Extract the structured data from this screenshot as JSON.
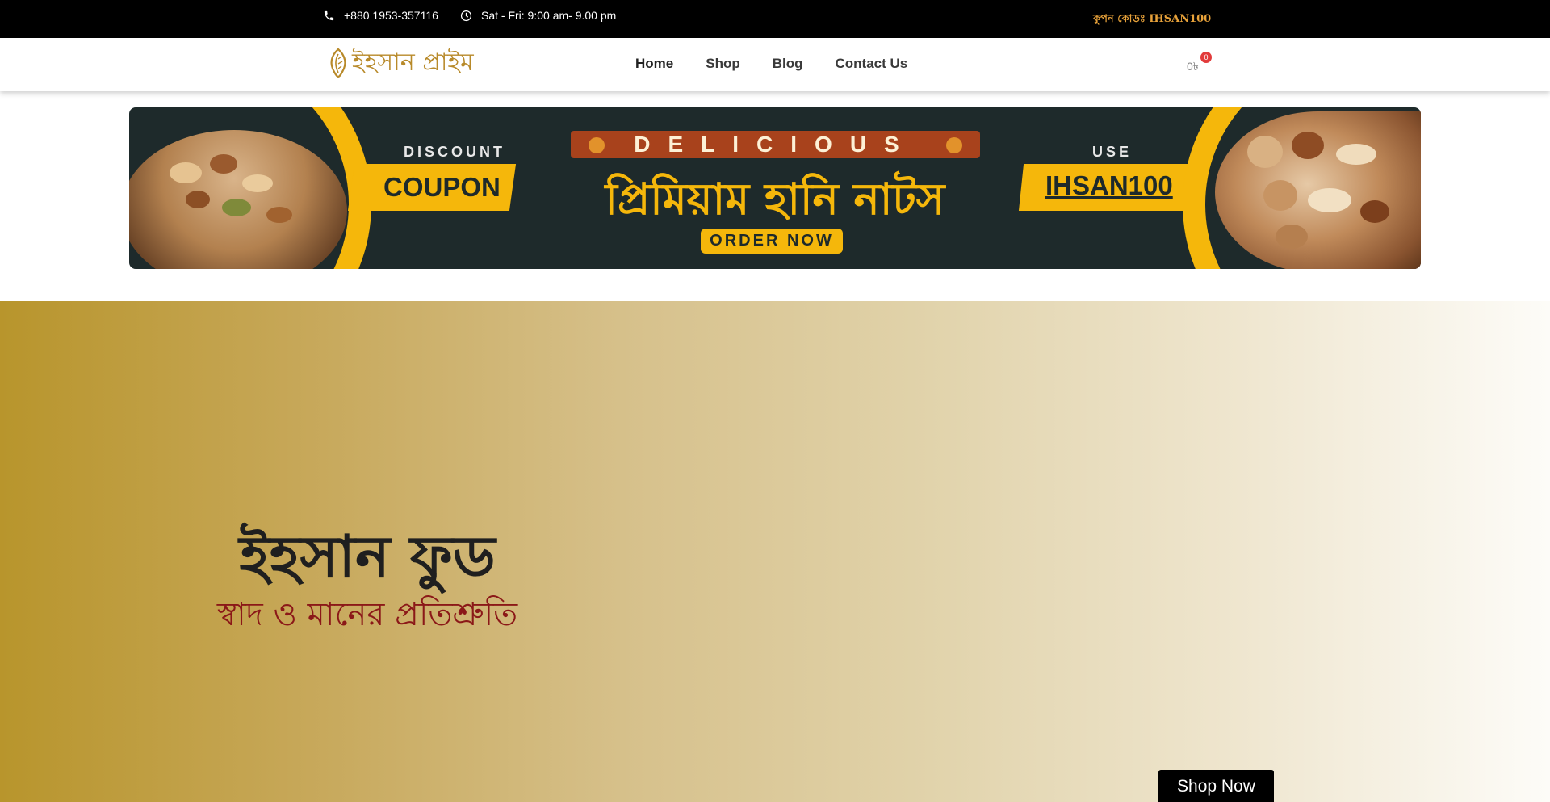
{
  "topbar": {
    "phone_icon": "phone-icon",
    "phone": "+880 1953-357116",
    "clock_icon": "clock-icon",
    "hours": "Sat - Fri: 9:00 am- 9.00 pm",
    "coupon": "কুপন কোডঃ IHSAN100"
  },
  "header": {
    "logo_text": "ইহসান প্রাইম",
    "nav": [
      {
        "label": "Home"
      },
      {
        "label": "Shop"
      },
      {
        "label": "Blog"
      },
      {
        "label": "Contact Us"
      }
    ],
    "cart_total": "0৳",
    "cart_count": "0"
  },
  "banner": {
    "discount_label": "DISCOUNT",
    "coupon_label": "COUPON",
    "delicious": "DELICIOUS",
    "headline": "প্রিমিয়াম হানি নাটস",
    "order_button": "ORDER NOW",
    "use_label": "USE",
    "code": "IHSAN100"
  },
  "hero": {
    "title": "ইহসান ফুড",
    "subtitle": "স্বাদ ও মানের প্রতিশ্রুতি",
    "button": "Shop Now"
  },
  "colors": {
    "accent_yellow": "#f5b70b",
    "banner_bg": "#1e2a2b",
    "coupon_orange": "#e8a23a",
    "subtitle_red": "#8b1818"
  }
}
